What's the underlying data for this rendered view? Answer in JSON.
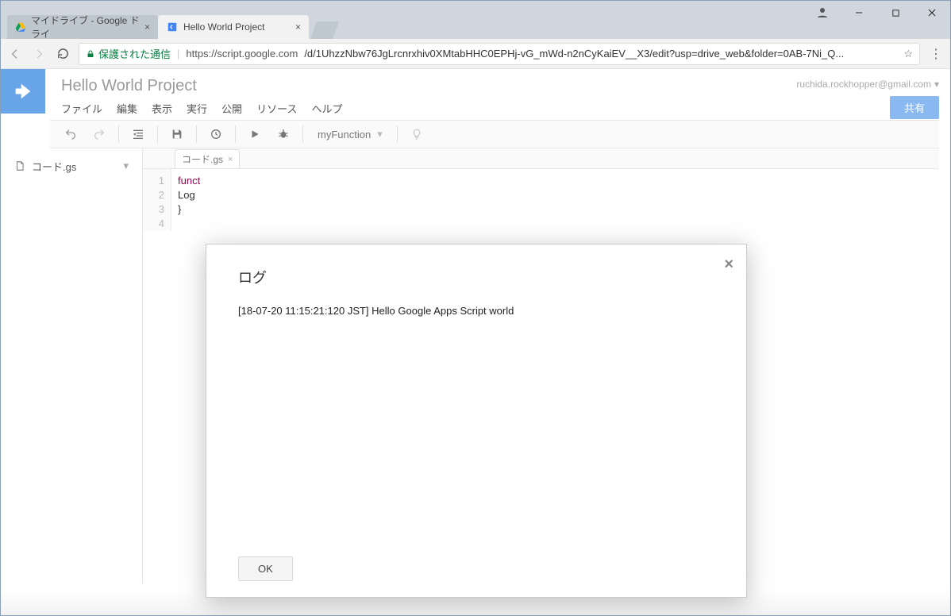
{
  "window": {
    "user_icon": "account",
    "minimize": "–",
    "maximize": "☐",
    "close": "✕"
  },
  "browser_tabs": [
    {
      "title": "マイドライブ - Google ドライ",
      "active": false
    },
    {
      "title": "Hello World Project",
      "active": true
    }
  ],
  "addressbar": {
    "secure_label": "保護された通信",
    "url_host": "https://script.google.com",
    "url_path": "/d/1UhzzNbw76JgLrcnrxhiv0XMtabHHC0EPHj-vG_mWd-n2nCyKaiEV__X3/edit?usp=drive_web&folder=0AB-7Ni_Q..."
  },
  "app": {
    "project_title": "Hello World Project",
    "user_email": "ruchida.rockhopper@gmail.com",
    "share_label": "共有",
    "menus": [
      "ファイル",
      "編集",
      "表示",
      "実行",
      "公開",
      "リソース",
      "ヘルプ"
    ],
    "function_selected": "myFunction"
  },
  "files": [
    {
      "name": "コード.gs"
    }
  ],
  "editor": {
    "tab_label": "コード.gs",
    "lines": {
      "l1_kw": "funct",
      "l2": "  Log",
      "l3": "}",
      "l4": ""
    },
    "line_numbers": [
      "1",
      "2",
      "3",
      "4"
    ]
  },
  "modal": {
    "title": "ログ",
    "log_line": "[18-07-20 11:15:21:120 JST] Hello Google Apps Script world",
    "ok_label": "OK"
  }
}
